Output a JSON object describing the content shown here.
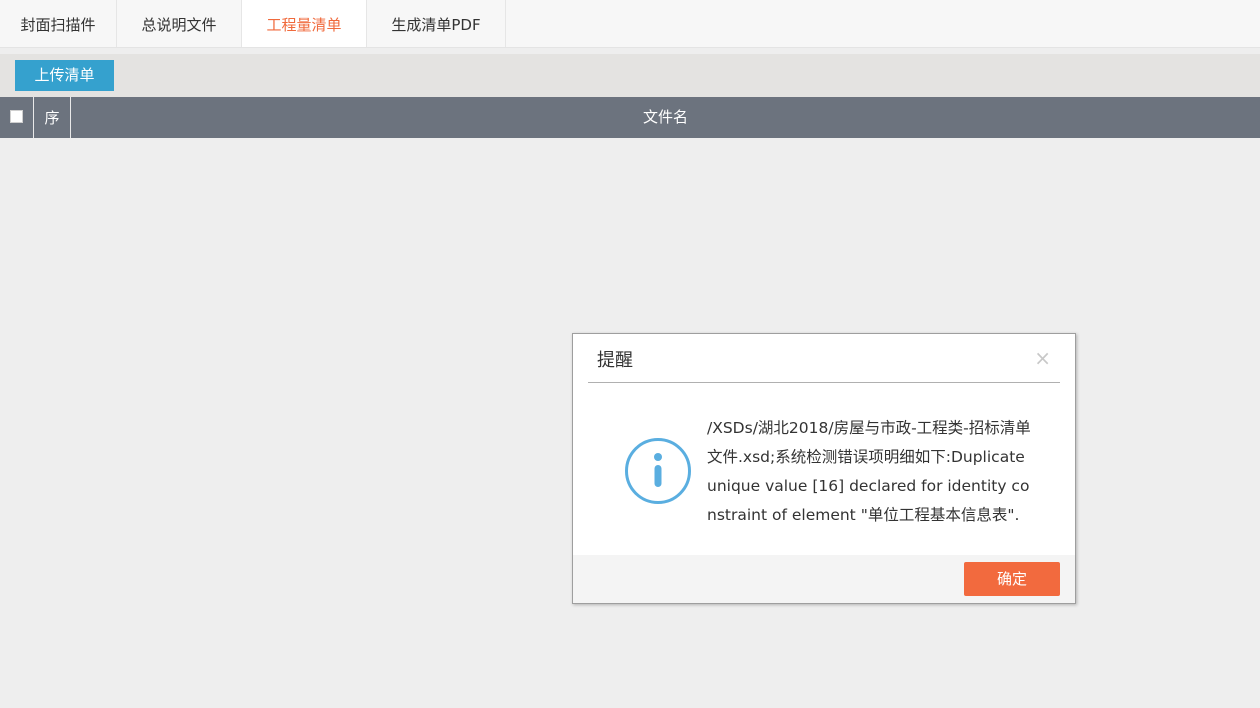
{
  "tabs": [
    {
      "label": "封面扫描件",
      "active": false
    },
    {
      "label": "总说明文件",
      "active": false
    },
    {
      "label": "工程量清单",
      "active": true
    },
    {
      "label": "生成清单PDF",
      "active": false
    }
  ],
  "toolbar": {
    "upload_label": "上传清单"
  },
  "grid": {
    "columns": [
      "序",
      "文件名"
    ]
  },
  "dialog": {
    "title": "提醒",
    "close_glyph": "×",
    "icon": "info-icon",
    "message": "/XSDs/湖北2018/房屋与市政-工程类-招标清单文件.xsd;系统检测错误项明细如下:Duplicate unique value [16] declared for identity constraint of element \"单位工程基本信息表\".",
    "ok_label": "确定"
  },
  "colors": {
    "accent": "#f06a3c",
    "upload_button": "#35a1ce",
    "header_bg": "#6c737e",
    "info_icon": "#5aaee0"
  }
}
